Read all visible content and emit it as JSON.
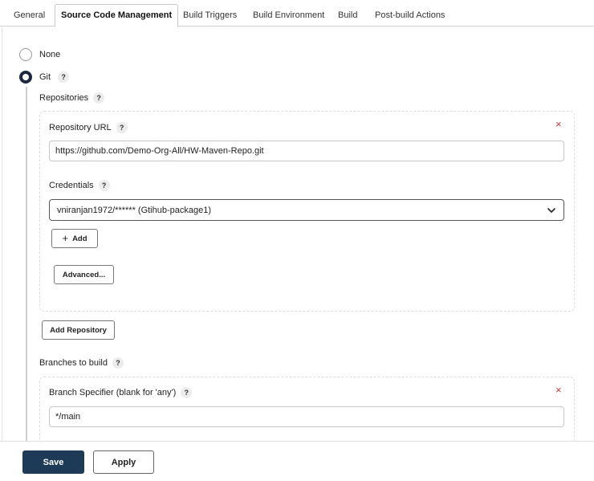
{
  "tabs": [
    {
      "label": "General"
    },
    {
      "label": "Source Code Management"
    },
    {
      "label": "Build Triggers"
    },
    {
      "label": "Build Environment"
    },
    {
      "label": "Build"
    },
    {
      "label": "Post-build Actions"
    }
  ],
  "active_tab": "Source Code Management",
  "scm": {
    "options": [
      {
        "label": "None",
        "selected": false
      },
      {
        "label": "Git",
        "selected": true
      }
    ],
    "help_glyph": "?",
    "repositories": {
      "label": "Repositories",
      "repository_url": {
        "label": "Repository URL",
        "value": "https://github.com/Demo-Org-All/HW-Maven-Repo.git"
      },
      "credentials": {
        "label": "Credentials",
        "selected": "vniranjan1972/****** (Gtihub-package1)",
        "add_label": "Add"
      },
      "advanced_label": "Advanced...",
      "add_repository_label": "Add Repository",
      "remove_glyph": "×"
    },
    "branches": {
      "label": "Branches to build",
      "specifier": {
        "label": "Branch Specifier (blank for 'any')",
        "value": "*/main"
      }
    }
  },
  "footer": {
    "save_label": "Save",
    "apply_label": "Apply"
  },
  "colors": {
    "save_bg": "#1d3b57",
    "remove_x": "#d23a3a",
    "radio_checked": "#1c2a3c"
  }
}
